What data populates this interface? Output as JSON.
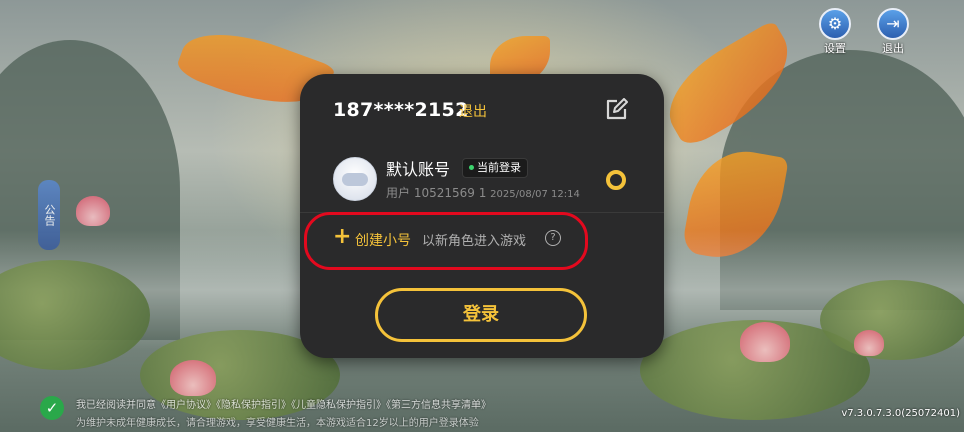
{
  "top_right": {
    "settings": {
      "icon": "gear-icon",
      "label": "设置"
    },
    "quit": {
      "icon": "exit-icon",
      "label": "退出"
    }
  },
  "side_tab": {
    "label": "公告"
  },
  "account_panel": {
    "phone": "187****2152",
    "logout_label": "退出",
    "edit_icon": "edit-icon",
    "current_account": {
      "name": "默认账号",
      "badge": "当前登录",
      "user_id": "用户 10521569 1",
      "last_login": "2025/08/07 12:14",
      "selected": true
    },
    "create_alt": {
      "label": "创建小号",
      "description": "以新角色进入游戏",
      "help_icon": "?"
    },
    "login_button": "登录"
  },
  "bottom": {
    "agreement_line1": "我已经阅读并同意《用户协议》《隐私保护指引》《儿童隐私保护指引》《第三方信息共享清单》",
    "agreement_line2": "为维护未成年健康成长，请合理游戏，享受健康生活，本游戏适合12岁以上的用户登录体验",
    "version": "v7.3.0.7.3.0(25072401)"
  },
  "colors": {
    "accent": "#f4c23a",
    "panel": "#2a2a2b",
    "highlight": "#e3091e",
    "online": "#3cd56d"
  }
}
